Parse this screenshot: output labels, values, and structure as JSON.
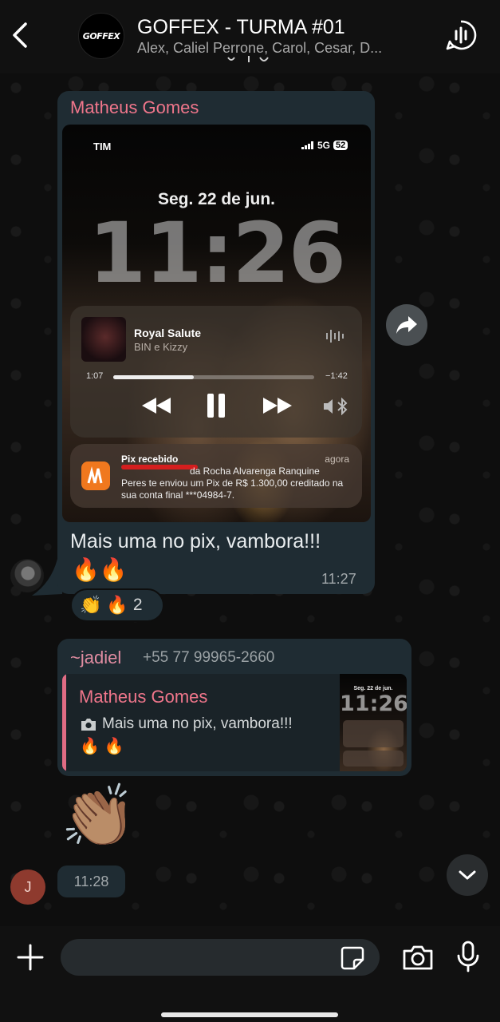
{
  "header": {
    "group_avatar_text": "GOFFEX",
    "title": "GOFFEX - TURMA #01",
    "members": "Alex, Caliel Perrone, Carol, Cesar, D..."
  },
  "messages": [
    {
      "sender": "Matheus Gomes",
      "screenshot": {
        "carrier": "TIM",
        "network": "5G",
        "battery": "52",
        "date": "Seg. 22 de jun.",
        "time": "11:26",
        "music": {
          "track": "Royal Salute",
          "artist": "BIN e Kizzy",
          "elapsed": "1:07",
          "remaining": "−1:42",
          "progress": 0.4
        },
        "notification": {
          "title": "Pix recebido",
          "time": "agora",
          "body_line1": "da Rocha Alvarenga Ranquine",
          "body_rest": "Peres te enviou um Pix de R$ 1.300,00 creditado na sua conta final ***04984-7."
        }
      },
      "caption": "Mais uma no pix, vambora!!!",
      "emoji_line": "🔥🔥",
      "time": "11:27",
      "reactions": {
        "emojis": [
          "👏",
          "🔥"
        ],
        "count": "2"
      }
    },
    {
      "sender": "~jadiel",
      "phone": "+55 77 99965-2660",
      "quote": {
        "name": "Matheus Gomes",
        "text": "Mais uma no pix, vambora!!!",
        "emoji_line": "🔥 🔥",
        "thumb_date": "Seg. 22 de jun.",
        "thumb_time": "11:26"
      },
      "sticker": "👏🏽",
      "time": "11:28",
      "avatar_initial": "J"
    }
  ],
  "composer": {
    "placeholder": ""
  }
}
